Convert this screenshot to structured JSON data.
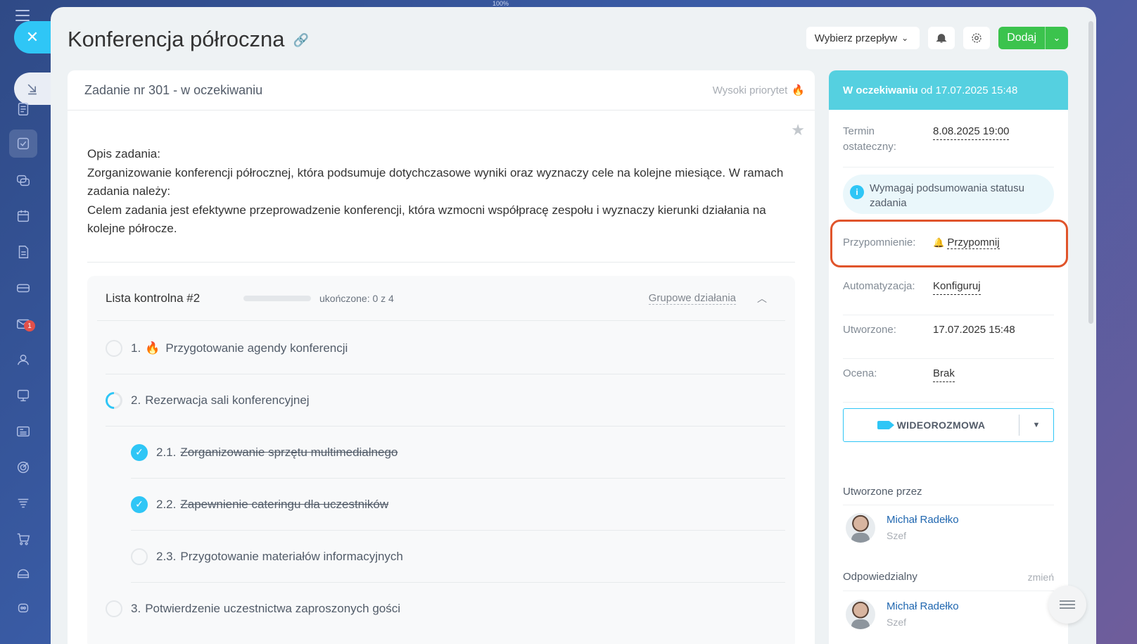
{
  "zoom": "100%",
  "task": {
    "title": "Konferencja półroczna",
    "header": "Zadanie nr 301 - w oczekiwaniu",
    "priority": "Wysoki priorytet",
    "description": [
      "Opis zadania:",
      "Zorganizowanie konferencji półrocznej, która podsumuje dotychczasowe wyniki oraz wyznaczy cele na kolejne miesiące. W ramach zadania należy:",
      "Celem zadania jest efektywne przeprowadzenie konferencji, która wzmocni współpracę zespołu i wyznaczy kierunki działania na kolejne półrocze."
    ]
  },
  "toolbar": {
    "flow_label": "Wybierz przepływ",
    "add_label": "Dodaj"
  },
  "checklist": {
    "name": "Lista kontrolna #2",
    "progress": "ukończone: 0 z 4",
    "progress_fraction": 0,
    "group_actions": "Grupowe działania",
    "items": [
      {
        "num": "1.",
        "text": "Przygotowanie agendy konferencji",
        "state": "open",
        "important": true
      },
      {
        "num": "2.",
        "text": "Rezerwacja sali konferencyjnej",
        "state": "partial"
      },
      {
        "num": "2.1.",
        "text": "Zorganizowanie sprzętu multimedialnego",
        "state": "done"
      },
      {
        "num": "2.2.",
        "text": "Zapewnienie cateringu dla uczestników",
        "state": "done"
      },
      {
        "num": "2.3.",
        "text": "Przygotowanie materiałów informacyjnych",
        "state": "open"
      },
      {
        "num": "3.",
        "text": "Potwierdzenie uczestnictwa zaproszonych gości",
        "state": "open"
      }
    ]
  },
  "sidebar_panel": {
    "status_bold": "W oczekiwaniu",
    "status_rest": "od 17.07.2025 15:48",
    "deadline_label": "Termin ostateczny:",
    "deadline_value": "8.08.2025 19:00",
    "info_text": "Wymagaj podsumowania statusu zadania",
    "reminder_label": "Przypomnienie:",
    "reminder_value": "Przypomnij",
    "automation_label": "Automatyzacja:",
    "automation_value": "Konfiguruj",
    "created_label": "Utworzone:",
    "created_value": "17.07.2025 15:48",
    "rating_label": "Ocena:",
    "rating_value": "Brak",
    "video_label": "WIDEOROZMOWA",
    "created_by_title": "Utworzone przez",
    "creator_name": "Michał Radełko",
    "creator_role": "Szef",
    "responsible_title": "Odpowiedzialny",
    "change_label": "zmień",
    "responsible_name": "Michał Radełko",
    "responsible_role": "Szef"
  },
  "badges": {
    "mail_count": "1"
  },
  "colors": {
    "accent": "#2fc6f6",
    "add": "#3bc34d",
    "status": "#55d0e0",
    "highlight": "#e0542b"
  }
}
